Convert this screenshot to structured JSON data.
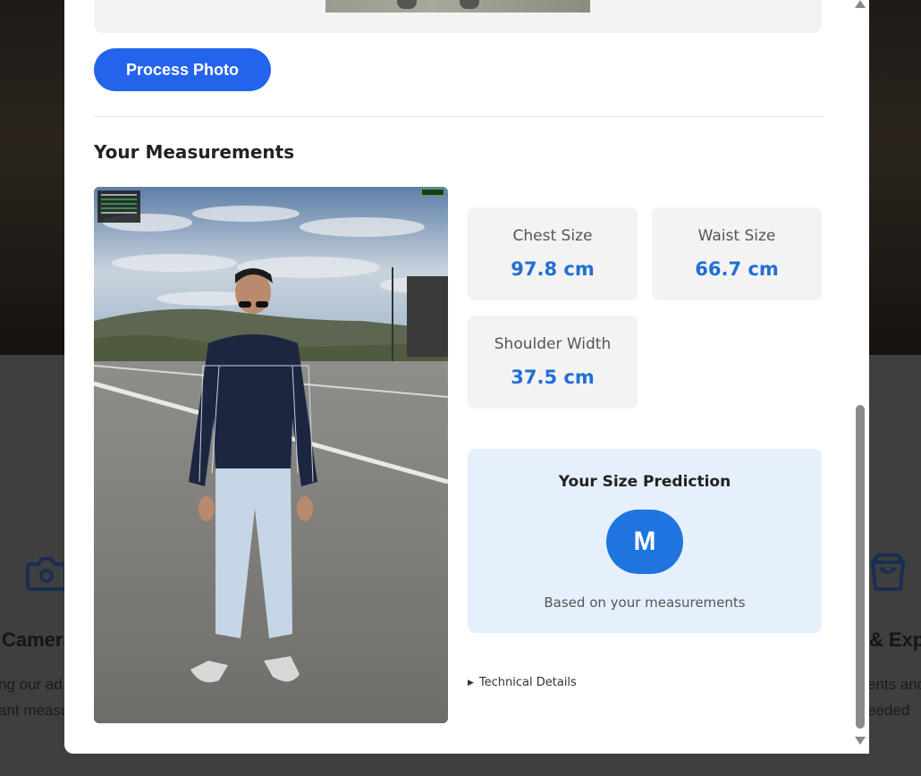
{
  "background": {
    "left_feature": {
      "icon": "camera-icon",
      "title": "Camera",
      "lines": [
        "ng our ad",
        "ant measu"
      ]
    },
    "right_feature": {
      "icon": "shopping-bag-icon",
      "title": "& Exp",
      "lines": [
        "ents and",
        "eeded"
      ]
    }
  },
  "modal": {
    "process_button": "Process Photo",
    "section_title": "Your Measurements",
    "measurements": [
      {
        "label": "Chest Size",
        "value": "97.8 cm"
      },
      {
        "label": "Waist Size",
        "value": "66.7 cm"
      },
      {
        "label": "Shoulder Width",
        "value": "37.5 cm"
      }
    ],
    "prediction": {
      "title": "Your Size Prediction",
      "size": "M",
      "note": "Based on your measurements"
    },
    "technical_details": "Technical Details"
  },
  "colors": {
    "primary_button": "#2463eb",
    "measurement_value": "#1f6fd6",
    "prediction_bg": "#e5f0fc",
    "size_badge": "#1f74e0"
  }
}
